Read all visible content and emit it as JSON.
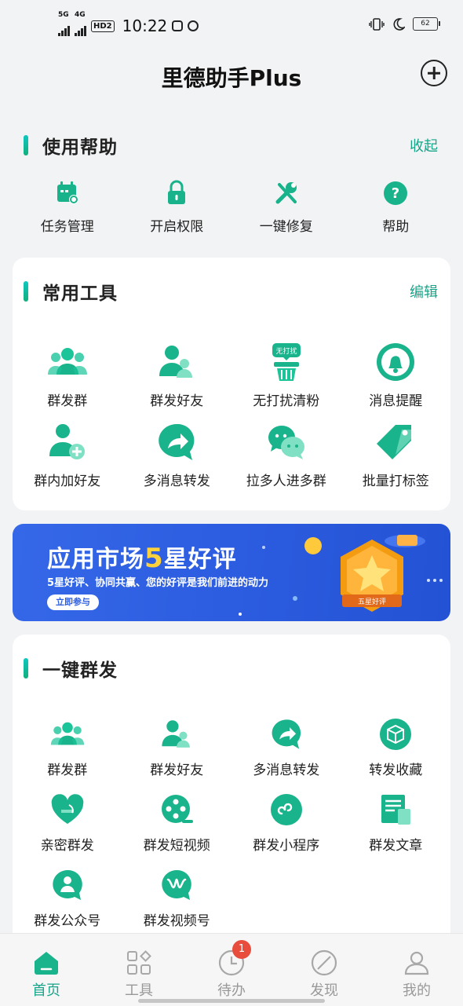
{
  "status_bar": {
    "sim1": "5G",
    "sim2": "4G",
    "hd": "HD2",
    "time": "10:22",
    "battery": "62"
  },
  "header": {
    "title": "里德助手Plus"
  },
  "help_section": {
    "title": "使用帮助",
    "action": "收起",
    "items": [
      {
        "label": "任务管理",
        "icon": "calendar-gear-icon"
      },
      {
        "label": "开启权限",
        "icon": "lock-icon"
      },
      {
        "label": "一键修复",
        "icon": "tools-icon"
      },
      {
        "label": "帮助",
        "icon": "question-icon"
      }
    ]
  },
  "tools_section": {
    "title": "常用工具",
    "action": "编辑",
    "items": [
      {
        "label": "群发群",
        "icon": "group-icon"
      },
      {
        "label": "群发好友",
        "icon": "friends-icon"
      },
      {
        "label": "无打扰清粉",
        "icon": "no-disturb-clean-icon",
        "tag": "无打扰"
      },
      {
        "label": "消息提醒",
        "icon": "bell-icon"
      },
      {
        "label": "群内加好友",
        "icon": "add-friend-icon"
      },
      {
        "label": "多消息转发",
        "icon": "forward-icon"
      },
      {
        "label": "拉多人进多群",
        "icon": "chat-bubbles-icon"
      },
      {
        "label": "批量打标签",
        "icon": "tag-icon"
      }
    ]
  },
  "banner": {
    "title_pre": "应用市场",
    "title_highlight": "5",
    "title_post": "星好评",
    "subtitle": "5星好评、协同共赢、您的好评是我们前进的动力",
    "button": "立即参与",
    "badge_text": "五星好评"
  },
  "broadcast_section": {
    "title": "一键群发",
    "items": [
      {
        "label": "群发群",
        "icon": "group-icon"
      },
      {
        "label": "群发好友",
        "icon": "friends-icon"
      },
      {
        "label": "多消息转发",
        "icon": "forward-icon"
      },
      {
        "label": "转发收藏",
        "icon": "cube-icon"
      },
      {
        "label": "亲密群发",
        "icon": "heart-icon"
      },
      {
        "label": "群发短视频",
        "icon": "film-reel-icon"
      },
      {
        "label": "群发小程序",
        "icon": "mini-program-icon"
      },
      {
        "label": "群发文章",
        "icon": "article-icon"
      },
      {
        "label": "群发公众号",
        "icon": "official-account-icon"
      },
      {
        "label": "群发视频号",
        "icon": "channels-icon"
      }
    ]
  },
  "bottom_nav": {
    "items": [
      {
        "label": "首页",
        "icon": "home-icon",
        "active": true
      },
      {
        "label": "工具",
        "icon": "grid-icon",
        "active": false
      },
      {
        "label": "待办",
        "icon": "clock-icon",
        "active": false,
        "badge": "1"
      },
      {
        "label": "发现",
        "icon": "compass-icon",
        "active": false
      },
      {
        "label": "我的",
        "icon": "person-icon",
        "active": false
      }
    ]
  },
  "colors": {
    "accent": "#17a589",
    "banner": "#2c5ce0",
    "badge": "#e84c3d"
  }
}
